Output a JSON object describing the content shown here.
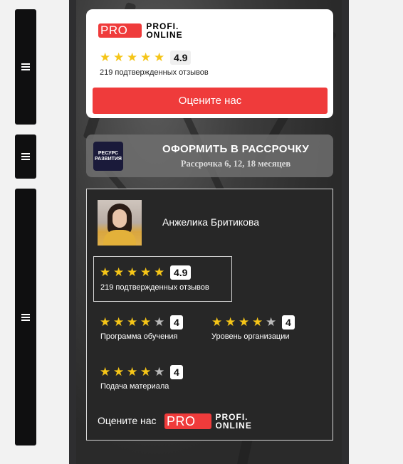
{
  "menu": [
    {
      "icon": "hamburger-icon"
    },
    {
      "icon": "hamburger-icon"
    },
    {
      "icon": "hamburger-icon"
    }
  ],
  "logo": {
    "pro": "PRO",
    "line1": "PROFI.",
    "line2": "ONLINE"
  },
  "top_card": {
    "rating": "4.9",
    "stars": 5,
    "reviews": "219 подтвержденных отзывов",
    "button": "Оцените нас"
  },
  "installment": {
    "logo_line1": "РЕСУРС",
    "logo_line2": "РАЗВИТИЯ",
    "title": "ОФОРМИТЬ В РАССРОЧКУ",
    "subtitle": "Рассрочка 6, 12, 18 месяцев"
  },
  "review_card": {
    "name": "Анжелика Бритикова",
    "rating": "4.9",
    "stars": 5,
    "reviews": "219 подтвержденных отзывов",
    "criteria": [
      {
        "label": "Программа обучения",
        "score": "4",
        "stars": 4
      },
      {
        "label": "Уровень организации",
        "score": "4",
        "stars": 4
      },
      {
        "label": "Подача материала",
        "score": "4",
        "stars": 4
      }
    ],
    "footer": "Оцените нас"
  },
  "colors": {
    "accent": "#ef3b3b",
    "star": "#f5c518"
  }
}
